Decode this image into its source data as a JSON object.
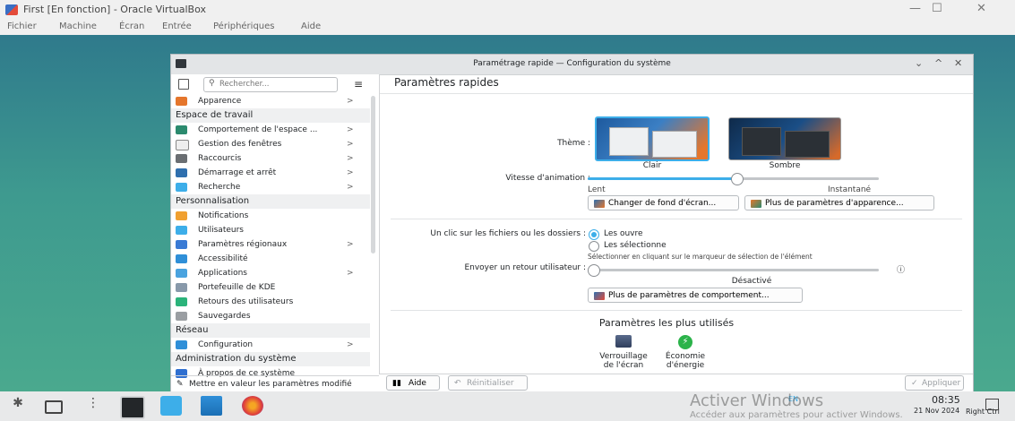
{
  "vbox": {
    "title": "First [En fonction] - Oracle VirtualBox",
    "menu": [
      "Fichier",
      "Machine",
      "Écran",
      "Entrée",
      "Périphériques",
      "Aide"
    ],
    "controls": {
      "minimize": "—",
      "maximize": "☐",
      "close": "✕"
    }
  },
  "window": {
    "title": "Paramétrage rapide — Configuration du système",
    "controls": {
      "down": "⌄",
      "up": "^",
      "close": "✕"
    }
  },
  "sidebar": {
    "search_placeholder": "Rechercher...",
    "items": [
      {
        "label": "Apparence",
        "chevron": ">",
        "icon": "appearance-icon",
        "color": "#e5762c"
      },
      {
        "header": "Espace de travail"
      },
      {
        "label": "Comportement de l'espace ...",
        "chevron": ">",
        "icon": "workspace-icon",
        "color": "#2b8a6e"
      },
      {
        "label": "Gestion des fenêtres",
        "chevron": ">",
        "icon": "windows-icon",
        "color": "#eeeeee"
      },
      {
        "label": "Raccourcis",
        "chevron": ">",
        "icon": "keyboard-icon",
        "color": "#6a6e72"
      },
      {
        "label": "Démarrage et arrêt",
        "chevron": ">",
        "icon": "startup-icon",
        "color": "#2f6fae"
      },
      {
        "label": "Recherche",
        "chevron": ">",
        "icon": "search-icon",
        "color": "#3daee9"
      },
      {
        "header": "Personnalisation"
      },
      {
        "label": "Notifications",
        "chevron": "",
        "icon": "bell-icon",
        "color": "#f0a030"
      },
      {
        "label": "Utilisateurs",
        "chevron": "",
        "icon": "users-icon",
        "color": "#3daee9"
      },
      {
        "label": "Paramètres régionaux",
        "chevron": ">",
        "icon": "region-icon",
        "color": "#3a7bd5"
      },
      {
        "label": "Accessibilité",
        "chevron": "",
        "icon": "accessibility-icon",
        "color": "#2f8fd8"
      },
      {
        "label": "Applications",
        "chevron": ">",
        "icon": "apps-icon",
        "color": "#4aa3df"
      },
      {
        "label": "Portefeuille de KDE",
        "chevron": "",
        "icon": "wallet-icon",
        "color": "#8899aa"
      },
      {
        "label": "Retours des utilisateurs",
        "chevron": "",
        "icon": "feedback-icon",
        "color": "#2bb37a"
      },
      {
        "label": "Sauvegardes",
        "chevron": "",
        "icon": "backup-icon",
        "color": "#9a9ea2"
      },
      {
        "header": "Réseau"
      },
      {
        "label": "Configuration",
        "chevron": ">",
        "icon": "network-icon",
        "color": "#2f8fd8"
      },
      {
        "header": "Administration du système"
      },
      {
        "label": "À propos de ce système",
        "chevron": "",
        "icon": "info-icon",
        "color": "#2f6fd0"
      }
    ],
    "footer": "Mettre en valeur les paramètres modifié"
  },
  "main": {
    "title": "Paramètres rapides",
    "theme_label": "Thème :",
    "theme_light": "Clair",
    "theme_dark": "Sombre",
    "anim_label": "Vitesse d'animation :",
    "anim_min": "Lent",
    "anim_max": "Instantané",
    "anim_value": 0.51,
    "btn_wallpaper": "Changer de fond d'écran...",
    "btn_appearance": "Plus de paramètres d'apparence...",
    "click_label": "Un clic sur les fichiers ou les dossiers :",
    "click_open": "Les ouvre",
    "click_select": "Les sélectionne",
    "click_hint": "Sélectionner en cliquant sur le marqueur de sélection de l'élément",
    "feedback_label": "Envoyer un retour utilisateur :",
    "feedback_value_text": "Désactivé",
    "feedback_value": 0,
    "feedback_info": "ⓘ",
    "btn_behavior": "Plus de paramètres de comportement...",
    "most_used_title": "Paramètres les plus utilisés",
    "most_used": [
      {
        "line1": "Verrouillage",
        "line2": "de l'écran",
        "icon": "lock-screen-icon"
      },
      {
        "line1": "Économie",
        "line2": "d'énergie",
        "icon": "power-icon"
      }
    ]
  },
  "footer": {
    "help": "Aide",
    "reset": "Réinitialiser",
    "apply": "Appliquer"
  },
  "taskbar": {
    "time": "08:35",
    "date": "21 Nov 2024",
    "lang": "EN",
    "host_key": "Right Ctrl"
  },
  "watermark": {
    "line1": "Activer Windows",
    "line2": "Accéder aux paramètres pour activer Windows."
  }
}
